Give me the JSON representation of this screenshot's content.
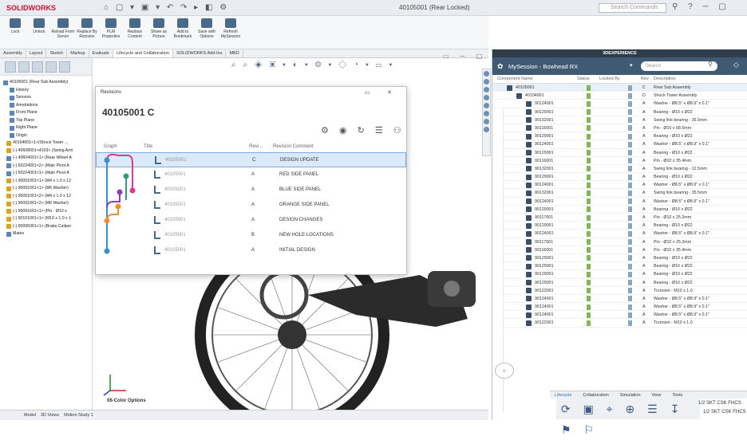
{
  "titlebar": {
    "logo": "SOLIDWORKS",
    "doc_title": "40105001 (Rear Locked)",
    "search_placeholder": "Search Commands"
  },
  "ribbon": [
    {
      "label": "Lock"
    },
    {
      "label": "Unlock"
    },
    {
      "label": "Reload From Server"
    },
    {
      "label": "Replace By Revision"
    },
    {
      "label": "PLM Properties"
    },
    {
      "label": "Replace Content"
    },
    {
      "label": "Share as Picture"
    },
    {
      "label": "Add to Bookmark"
    },
    {
      "label": "Save with Options"
    },
    {
      "label": "Refresh MySession"
    }
  ],
  "cm_tabs": [
    "Assembly",
    "Layout",
    "Sketch",
    "Markup",
    "Evaluate",
    "Lifecycle and Collaboration",
    "SOLIDWORKS Add-Ins",
    "MBD"
  ],
  "tree": [
    {
      "label": "40105001 (Rear Sub Assembly)",
      "y": false
    },
    {
      "label": "History",
      "y": false
    },
    {
      "label": "Sensors",
      "y": false
    },
    {
      "label": "Annotations",
      "y": false
    },
    {
      "label": "Front Plane",
      "y": false
    },
    {
      "label": "Top Plane",
      "y": false
    },
    {
      "label": "Right Plane",
      "y": false
    },
    {
      "label": "Origin",
      "y": false
    },
    {
      "label": "40104001<1>(Shock Tower ...",
      "y": true
    },
    {
      "label": "(-) 40608001<4103> (Swing Arm",
      "y": true
    },
    {
      "label": "(-) 40604001<1> (Rear Wheel A",
      "y": false
    },
    {
      "label": "(-) 60224001<2> (Main Pivot A",
      "y": false
    },
    {
      "label": "(-) 60224001<1> (Main Pivot A",
      "y": false
    },
    {
      "label": "(-) 90091001<1> (M4 x 1.0 x 12",
      "y": true
    },
    {
      "label": "(-) 90091001<1> (M6 Washer)",
      "y": true
    },
    {
      "label": "(-) 90091001<2> (M4 x 1.0 x 12",
      "y": true
    },
    {
      "label": "(-) 90091001<2> (M6 Washer)",
      "y": true
    },
    {
      "label": "(-) 90091601<1> (Pin - Ø10 x",
      "y": true
    },
    {
      "label": "(-) 90101001<1> (M10 x 1.0 x 1",
      "y": true
    },
    {
      "label": "(-) 90095001<1> (Brake Caliper",
      "y": true
    },
    {
      "label": "Mates",
      "y": false
    }
  ],
  "bottom_tabs": [
    "Model",
    "3D Views",
    "Motion Study 1"
  ],
  "color_options_label": "06-Color Options",
  "revisions": {
    "header": "Revisions",
    "title": "40105001 C",
    "cols": {
      "graph": "Graph",
      "title": "Title",
      "rev": "Revi...",
      "comment": "Revision Comment"
    },
    "rows": [
      {
        "file": "40105001",
        "rev": "C",
        "comment": "DESIGN UPDATE",
        "sel": true
      },
      {
        "file": "40105001",
        "rev": "A",
        "comment": "RED SIDE PANEL",
        "sel": false
      },
      {
        "file": "40105001",
        "rev": "A",
        "comment": "BLUE SIDE PANEL",
        "sel": false
      },
      {
        "file": "40105001",
        "rev": "A",
        "comment": "ORANGE SIDE PANEL",
        "sel": false
      },
      {
        "file": "40105001",
        "rev": "A",
        "comment": "DESIGN CHANGES",
        "sel": false
      },
      {
        "file": "40105001",
        "rev": "B",
        "comment": "NEW HOLE LOCATIONS",
        "sel": false
      },
      {
        "file": "40105001",
        "rev": "A",
        "comment": "INITIAL DESIGN",
        "sel": false
      }
    ]
  },
  "explorer": {
    "header": "3DEXPERIENCE",
    "title": "MySession - Bowhead RX",
    "search_placeholder": "Search",
    "cols": {
      "name": "Component Name",
      "status": "Status",
      "locked": "Locked By",
      "rev": "Rev",
      "desc": "Description"
    },
    "rows": [
      {
        "name": "40105001",
        "rev": "C",
        "desc": "Rear Sub Assembly",
        "lvl": 0
      },
      {
        "name": "40104001",
        "rev": "D",
        "desc": "Shock Tower Assembly",
        "lvl": 1
      },
      {
        "name": "90124001",
        "rev": "A",
        "desc": "Washer - Ø8.5\" x Ø8.9\" x 0.1\"",
        "lvl": 2
      },
      {
        "name": "90129001",
        "rev": "A",
        "desc": "Bearing - Ø10 x Ø22",
        "lvl": 2
      },
      {
        "name": "90132001",
        "rev": "A",
        "desc": "Swing link bearing - 35.5mm",
        "lvl": 2
      },
      {
        "name": "90116001",
        "rev": "A",
        "desc": "Pin - Ø10 x 68.5mm",
        "lvl": 2
      },
      {
        "name": "90129001",
        "rev": "A",
        "desc": "Bearing - Ø10 x Ø22",
        "lvl": 2
      },
      {
        "name": "90124001",
        "rev": "A",
        "desc": "Washer - Ø8.5\" x Ø8.9\" x 0.1\"",
        "lvl": 2
      },
      {
        "name": "90129001",
        "rev": "A",
        "desc": "Bearing - Ø10 x Ø22",
        "lvl": 2
      },
      {
        "name": "90116001",
        "rev": "A",
        "desc": "Pin - Ø10 x 35.4mm",
        "lvl": 2
      },
      {
        "name": "90132001",
        "rev": "A",
        "desc": "Swing link bearing - 12.5mm",
        "lvl": 2
      },
      {
        "name": "90129001",
        "rev": "A",
        "desc": "Bearing - Ø10 x Ø22",
        "lvl": 2
      },
      {
        "name": "90124001",
        "rev": "A",
        "desc": "Washer - Ø8.5\" x Ø8.9\" x 0.1\"",
        "lvl": 2
      },
      {
        "name": "90132001",
        "rev": "A",
        "desc": "Swing link bearing - 35.5mm",
        "lvl": 2
      },
      {
        "name": "90124001",
        "rev": "A",
        "desc": "Washer - Ø8.5\" x Ø8.9\" x 0.1\"",
        "lvl": 2
      },
      {
        "name": "90129001",
        "rev": "A",
        "desc": "Bearing - Ø10 x Ø22",
        "lvl": 2
      },
      {
        "name": "90117001",
        "rev": "A",
        "desc": "Pin - Ø10 x 25.2mm",
        "lvl": 2
      },
      {
        "name": "90129001",
        "rev": "A",
        "desc": "Bearing - Ø10 x Ø22",
        "lvl": 2
      },
      {
        "name": "90124001",
        "rev": "A",
        "desc": "Washer - Ø8.5\" x Ø8.9\" x 0.1\"",
        "lvl": 2
      },
      {
        "name": "90117001",
        "rev": "A",
        "desc": "Pin - Ø10 x 25.2mm",
        "lvl": 2
      },
      {
        "name": "90116001",
        "rev": "A",
        "desc": "Pin - Ø10 x 35.4mm",
        "lvl": 2
      },
      {
        "name": "90129001",
        "rev": "A",
        "desc": "Bearing - Ø10 x Ø22",
        "lvl": 2
      },
      {
        "name": "90129001",
        "rev": "A",
        "desc": "Bearing - Ø10 x Ø22",
        "lvl": 2
      },
      {
        "name": "90129001",
        "rev": "A",
        "desc": "Bearing - Ø10 x Ø22",
        "lvl": 2
      },
      {
        "name": "90129001",
        "rev": "A",
        "desc": "Bearing - Ø10 x Ø22",
        "lvl": 2
      },
      {
        "name": "90122001",
        "rev": "A",
        "desc": "Trunnion - M10 x 1.0",
        "lvl": 2
      },
      {
        "name": "90124001",
        "rev": "A",
        "desc": "Washer - Ø8.5\" x Ø8.9\" x 0.1\"",
        "lvl": 2
      },
      {
        "name": "90124001",
        "rev": "A",
        "desc": "Washer - Ø8.5\" x Ø8.9\" x 0.1\"",
        "lvl": 2
      },
      {
        "name": "90124001",
        "rev": "A",
        "desc": "Washer - Ø8.5\" x Ø8.9\" x 0.1\"",
        "lvl": 2
      },
      {
        "name": "90122001",
        "rev": "A",
        "desc": "Trunnion - M10 x 1.0",
        "lvl": 2
      }
    ],
    "bottom_tabs": [
      "Lifecycle",
      "Collaboration",
      "Simulation",
      "View",
      "Tools"
    ],
    "tail_labels": [
      "1/2 SKT CSK FHCS",
      "1/2 SKT CSK FHCS"
    ]
  }
}
